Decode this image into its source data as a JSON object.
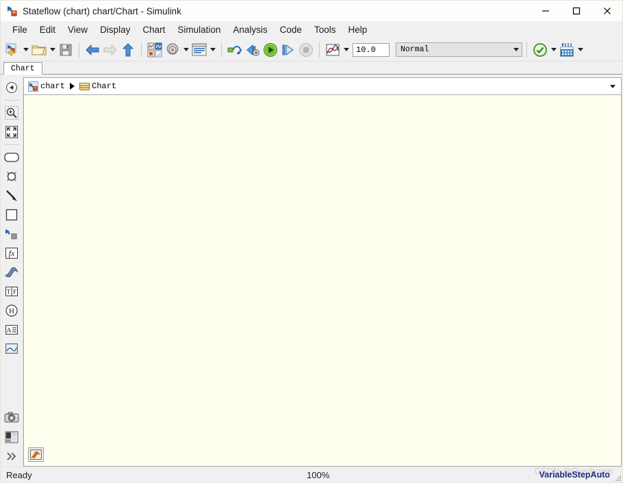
{
  "window": {
    "title": "Stateflow (chart) chart/Chart - Simulink",
    "icon": "stateflow-chart-icon",
    "controls": {
      "minimize": "—",
      "maximize": "☐",
      "close": "✕"
    }
  },
  "menubar": {
    "items": [
      {
        "label": "File"
      },
      {
        "label": "Edit"
      },
      {
        "label": "View"
      },
      {
        "label": "Display"
      },
      {
        "label": "Chart"
      },
      {
        "label": "Simulation"
      },
      {
        "label": "Analysis"
      },
      {
        "label": "Code"
      },
      {
        "label": "Tools"
      },
      {
        "label": "Help"
      }
    ]
  },
  "toolbar": {
    "new_model": "new-model-icon",
    "open_model": "open-folder-icon",
    "save_model": "save-icon",
    "back": "back-arrow-icon",
    "forward": "forward-arrow-icon",
    "up": "up-arrow-icon",
    "library_browser": "library-browser-icon",
    "model_configuration": "gear-icon",
    "model_explorer": "model-explorer-icon",
    "update_diagram": "update-diagram-icon",
    "build_model": "build-model-icon",
    "run": "run-icon",
    "step_forward": "step-forward-icon",
    "stop": "stop-icon",
    "data_inspector": "simulation-data-inspector-icon",
    "stop_time": "10.0",
    "sim_mode": "Normal",
    "model_advisor": "model-advisor-check-icon",
    "chart_tools": "chart-tools-icon"
  },
  "tabs": [
    {
      "label": "Chart",
      "active": true
    }
  ],
  "palette": {
    "items": [
      {
        "name": "navigate-back",
        "icon": "back-circle-icon"
      },
      {
        "name": "zoom-in",
        "icon": "zoom-in-icon"
      },
      {
        "name": "fit-to-view",
        "icon": "fit-to-view-icon"
      },
      {
        "name": "state",
        "icon": "state-icon"
      },
      {
        "name": "history-junction",
        "icon": "junction-icon"
      },
      {
        "name": "default-transition",
        "icon": "default-transition-icon"
      },
      {
        "name": "box",
        "icon": "box-icon"
      },
      {
        "name": "graphical-function",
        "icon": "graphical-function-icon"
      },
      {
        "name": "function-call",
        "icon": "function-icon"
      },
      {
        "name": "matlab-function",
        "icon": "matlab-function-icon"
      },
      {
        "name": "truth-table",
        "icon": "truth-table-icon"
      },
      {
        "name": "simulink-function",
        "icon": "simulink-function-icon"
      },
      {
        "name": "annotation",
        "icon": "annotation-icon"
      },
      {
        "name": "image",
        "icon": "image-icon"
      },
      {
        "name": "snapshot",
        "icon": "camera-icon"
      },
      {
        "name": "layers",
        "icon": "layers-icon"
      },
      {
        "name": "overflow",
        "icon": "chevron-double-right-icon"
      }
    ]
  },
  "breadcrumb": {
    "model": "chart",
    "chart": "Chart",
    "model_icon": "stateflow-model-icon",
    "chart_icon": "chart-block-icon"
  },
  "canvas": {
    "background": "#fffff0",
    "matlab_button": "matlab-logo-icon"
  },
  "statusbar": {
    "status": "Ready",
    "zoom": "100%",
    "solver": "VariableStepAuto",
    "watermark": "CSDN @Overboom"
  },
  "colors": {
    "canvas": "#fffff0",
    "chrome": "#f0f0f0",
    "accent_green": "#4da82e",
    "accent_blue": "#2a6fb5",
    "solver_text": "#1c2d7a"
  }
}
